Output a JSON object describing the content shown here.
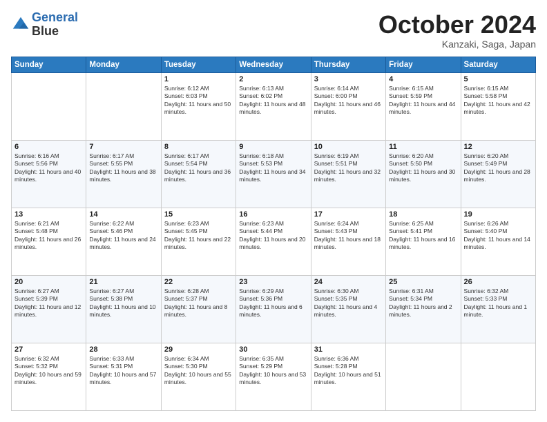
{
  "header": {
    "logo_line1": "General",
    "logo_line2": "Blue",
    "month": "October 2024",
    "location": "Kanzaki, Saga, Japan"
  },
  "weekdays": [
    "Sunday",
    "Monday",
    "Tuesday",
    "Wednesday",
    "Thursday",
    "Friday",
    "Saturday"
  ],
  "weeks": [
    [
      {
        "day": "",
        "sunrise": "",
        "sunset": "",
        "daylight": ""
      },
      {
        "day": "",
        "sunrise": "",
        "sunset": "",
        "daylight": ""
      },
      {
        "day": "1",
        "sunrise": "Sunrise: 6:12 AM",
        "sunset": "Sunset: 6:03 PM",
        "daylight": "Daylight: 11 hours and 50 minutes."
      },
      {
        "day": "2",
        "sunrise": "Sunrise: 6:13 AM",
        "sunset": "Sunset: 6:02 PM",
        "daylight": "Daylight: 11 hours and 48 minutes."
      },
      {
        "day": "3",
        "sunrise": "Sunrise: 6:14 AM",
        "sunset": "Sunset: 6:00 PM",
        "daylight": "Daylight: 11 hours and 46 minutes."
      },
      {
        "day": "4",
        "sunrise": "Sunrise: 6:15 AM",
        "sunset": "Sunset: 5:59 PM",
        "daylight": "Daylight: 11 hours and 44 minutes."
      },
      {
        "day": "5",
        "sunrise": "Sunrise: 6:15 AM",
        "sunset": "Sunset: 5:58 PM",
        "daylight": "Daylight: 11 hours and 42 minutes."
      }
    ],
    [
      {
        "day": "6",
        "sunrise": "Sunrise: 6:16 AM",
        "sunset": "Sunset: 5:56 PM",
        "daylight": "Daylight: 11 hours and 40 minutes."
      },
      {
        "day": "7",
        "sunrise": "Sunrise: 6:17 AM",
        "sunset": "Sunset: 5:55 PM",
        "daylight": "Daylight: 11 hours and 38 minutes."
      },
      {
        "day": "8",
        "sunrise": "Sunrise: 6:17 AM",
        "sunset": "Sunset: 5:54 PM",
        "daylight": "Daylight: 11 hours and 36 minutes."
      },
      {
        "day": "9",
        "sunrise": "Sunrise: 6:18 AM",
        "sunset": "Sunset: 5:53 PM",
        "daylight": "Daylight: 11 hours and 34 minutes."
      },
      {
        "day": "10",
        "sunrise": "Sunrise: 6:19 AM",
        "sunset": "Sunset: 5:51 PM",
        "daylight": "Daylight: 11 hours and 32 minutes."
      },
      {
        "day": "11",
        "sunrise": "Sunrise: 6:20 AM",
        "sunset": "Sunset: 5:50 PM",
        "daylight": "Daylight: 11 hours and 30 minutes."
      },
      {
        "day": "12",
        "sunrise": "Sunrise: 6:20 AM",
        "sunset": "Sunset: 5:49 PM",
        "daylight": "Daylight: 11 hours and 28 minutes."
      }
    ],
    [
      {
        "day": "13",
        "sunrise": "Sunrise: 6:21 AM",
        "sunset": "Sunset: 5:48 PM",
        "daylight": "Daylight: 11 hours and 26 minutes."
      },
      {
        "day": "14",
        "sunrise": "Sunrise: 6:22 AM",
        "sunset": "Sunset: 5:46 PM",
        "daylight": "Daylight: 11 hours and 24 minutes."
      },
      {
        "day": "15",
        "sunrise": "Sunrise: 6:23 AM",
        "sunset": "Sunset: 5:45 PM",
        "daylight": "Daylight: 11 hours and 22 minutes."
      },
      {
        "day": "16",
        "sunrise": "Sunrise: 6:23 AM",
        "sunset": "Sunset: 5:44 PM",
        "daylight": "Daylight: 11 hours and 20 minutes."
      },
      {
        "day": "17",
        "sunrise": "Sunrise: 6:24 AM",
        "sunset": "Sunset: 5:43 PM",
        "daylight": "Daylight: 11 hours and 18 minutes."
      },
      {
        "day": "18",
        "sunrise": "Sunrise: 6:25 AM",
        "sunset": "Sunset: 5:41 PM",
        "daylight": "Daylight: 11 hours and 16 minutes."
      },
      {
        "day": "19",
        "sunrise": "Sunrise: 6:26 AM",
        "sunset": "Sunset: 5:40 PM",
        "daylight": "Daylight: 11 hours and 14 minutes."
      }
    ],
    [
      {
        "day": "20",
        "sunrise": "Sunrise: 6:27 AM",
        "sunset": "Sunset: 5:39 PM",
        "daylight": "Daylight: 11 hours and 12 minutes."
      },
      {
        "day": "21",
        "sunrise": "Sunrise: 6:27 AM",
        "sunset": "Sunset: 5:38 PM",
        "daylight": "Daylight: 11 hours and 10 minutes."
      },
      {
        "day": "22",
        "sunrise": "Sunrise: 6:28 AM",
        "sunset": "Sunset: 5:37 PM",
        "daylight": "Daylight: 11 hours and 8 minutes."
      },
      {
        "day": "23",
        "sunrise": "Sunrise: 6:29 AM",
        "sunset": "Sunset: 5:36 PM",
        "daylight": "Daylight: 11 hours and 6 minutes."
      },
      {
        "day": "24",
        "sunrise": "Sunrise: 6:30 AM",
        "sunset": "Sunset: 5:35 PM",
        "daylight": "Daylight: 11 hours and 4 minutes."
      },
      {
        "day": "25",
        "sunrise": "Sunrise: 6:31 AM",
        "sunset": "Sunset: 5:34 PM",
        "daylight": "Daylight: 11 hours and 2 minutes."
      },
      {
        "day": "26",
        "sunrise": "Sunrise: 6:32 AM",
        "sunset": "Sunset: 5:33 PM",
        "daylight": "Daylight: 11 hours and 1 minute."
      }
    ],
    [
      {
        "day": "27",
        "sunrise": "Sunrise: 6:32 AM",
        "sunset": "Sunset: 5:32 PM",
        "daylight": "Daylight: 10 hours and 59 minutes."
      },
      {
        "day": "28",
        "sunrise": "Sunrise: 6:33 AM",
        "sunset": "Sunset: 5:31 PM",
        "daylight": "Daylight: 10 hours and 57 minutes."
      },
      {
        "day": "29",
        "sunrise": "Sunrise: 6:34 AM",
        "sunset": "Sunset: 5:30 PM",
        "daylight": "Daylight: 10 hours and 55 minutes."
      },
      {
        "day": "30",
        "sunrise": "Sunrise: 6:35 AM",
        "sunset": "Sunset: 5:29 PM",
        "daylight": "Daylight: 10 hours and 53 minutes."
      },
      {
        "day": "31",
        "sunrise": "Sunrise: 6:36 AM",
        "sunset": "Sunset: 5:28 PM",
        "daylight": "Daylight: 10 hours and 51 minutes."
      },
      {
        "day": "",
        "sunrise": "",
        "sunset": "",
        "daylight": ""
      },
      {
        "day": "",
        "sunrise": "",
        "sunset": "",
        "daylight": ""
      }
    ]
  ]
}
